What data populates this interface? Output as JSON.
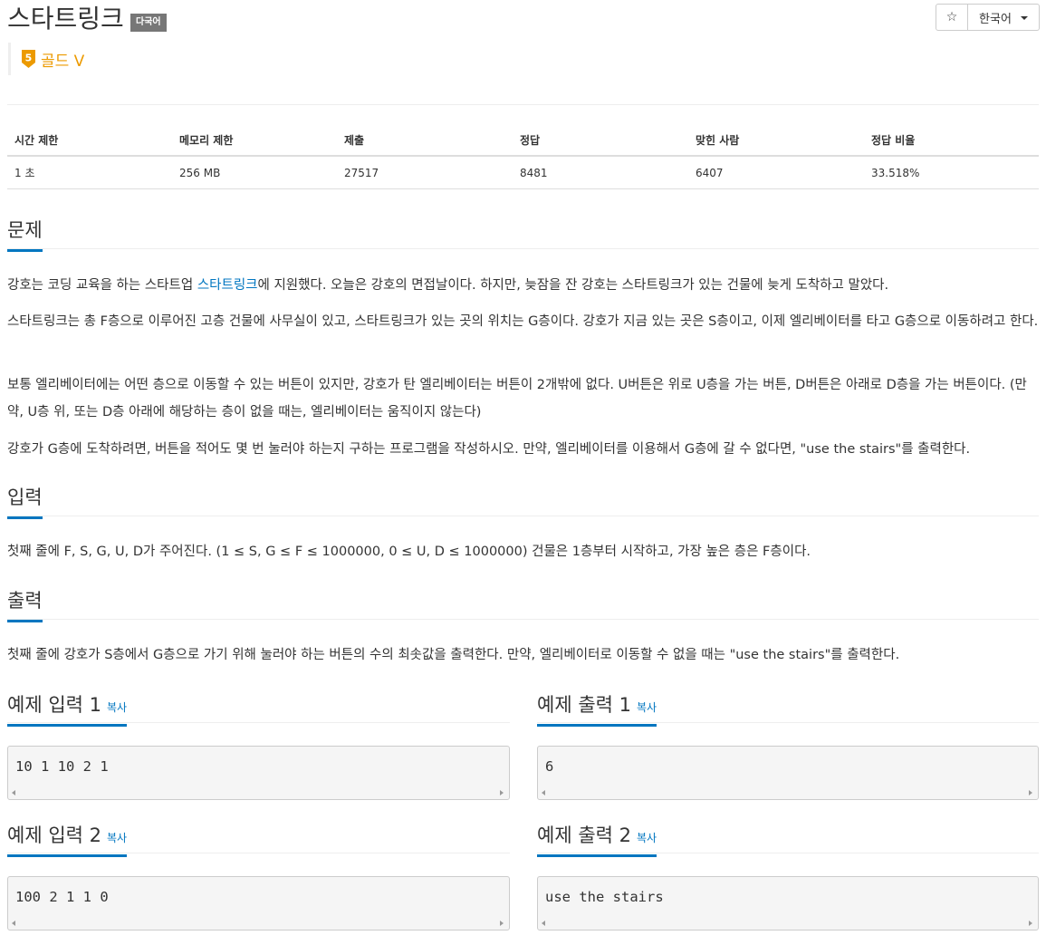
{
  "problem": {
    "title": "스타트링크",
    "multi_lang_badge": "다국어",
    "tier_number": "5",
    "tier_label": "골드 V"
  },
  "toolbar": {
    "star_label": "☆",
    "language": "한국어"
  },
  "info_table": {
    "headers": [
      "시간 제한",
      "메모리 제한",
      "제출",
      "정답",
      "맞힌 사람",
      "정답 비율"
    ],
    "values": [
      "1 초",
      "256 MB",
      "27517",
      "8481",
      "6407",
      "33.518%"
    ]
  },
  "sections": {
    "problem_title": "문제",
    "problem_p1_before": "강호는 코딩 교육을 하는 스타트업 ",
    "problem_p1_link": "스타트링크",
    "problem_p1_after": "에 지원했다. 오늘은 강호의 면접날이다. 하지만, 늦잠을 잔 강호는 스타트링크가 있는 건물에 늦게 도착하고 말았다.",
    "problem_p2": "스타트링크는 총 F층으로 이루어진 고층 건물에 사무실이 있고, 스타트링크가 있는 곳의 위치는 G층이다. 강호가 지금 있는 곳은 S층이고, 이제 엘리베이터를 타고 G층으로 이동하려고 한다.",
    "problem_p3": "보통 엘리베이터에는 어떤 층으로 이동할 수 있는 버튼이 있지만, 강호가 탄 엘리베이터는 버튼이 2개밖에 없다. U버튼은 위로 U층을 가는 버튼, D버튼은 아래로 D층을 가는 버튼이다. (만약, U층 위, 또는 D층 아래에 해당하는 층이 없을 때는, 엘리베이터는 움직이지 않는다)",
    "problem_p4": "강호가 G층에 도착하려면, 버튼을 적어도 몇 번 눌러야 하는지 구하는 프로그램을 작성하시오. 만약, 엘리베이터를 이용해서 G층에 갈 수 없다면, \"use the stairs\"를 출력한다.",
    "input_title": "입력",
    "input_p1": "첫째 줄에 F, S, G, U, D가 주어진다. (1 ≤ S, G ≤ F ≤ 1000000, 0 ≤ U, D ≤ 1000000) 건물은 1층부터 시작하고, 가장 높은 층은 F층이다.",
    "output_title": "출력",
    "output_p1": "첫째 줄에 강호가 S층에서 G층으로 가기 위해 눌러야 하는 버튼의 수의 최솟값을 출력한다. 만약, 엘리베이터로 이동할 수 없을 때는 \"use the stairs\"를 출력한다."
  },
  "samples": {
    "copy_label": "복사",
    "in1_title": "예제 입력 1",
    "in1_data": "10 1 10 2 1",
    "out1_title": "예제 출력 1",
    "out1_data": "6",
    "in2_title": "예제 입력 2",
    "in2_data": "100 2 1 1 0",
    "out2_title": "예제 출력 2",
    "out2_data": "use the stairs"
  }
}
